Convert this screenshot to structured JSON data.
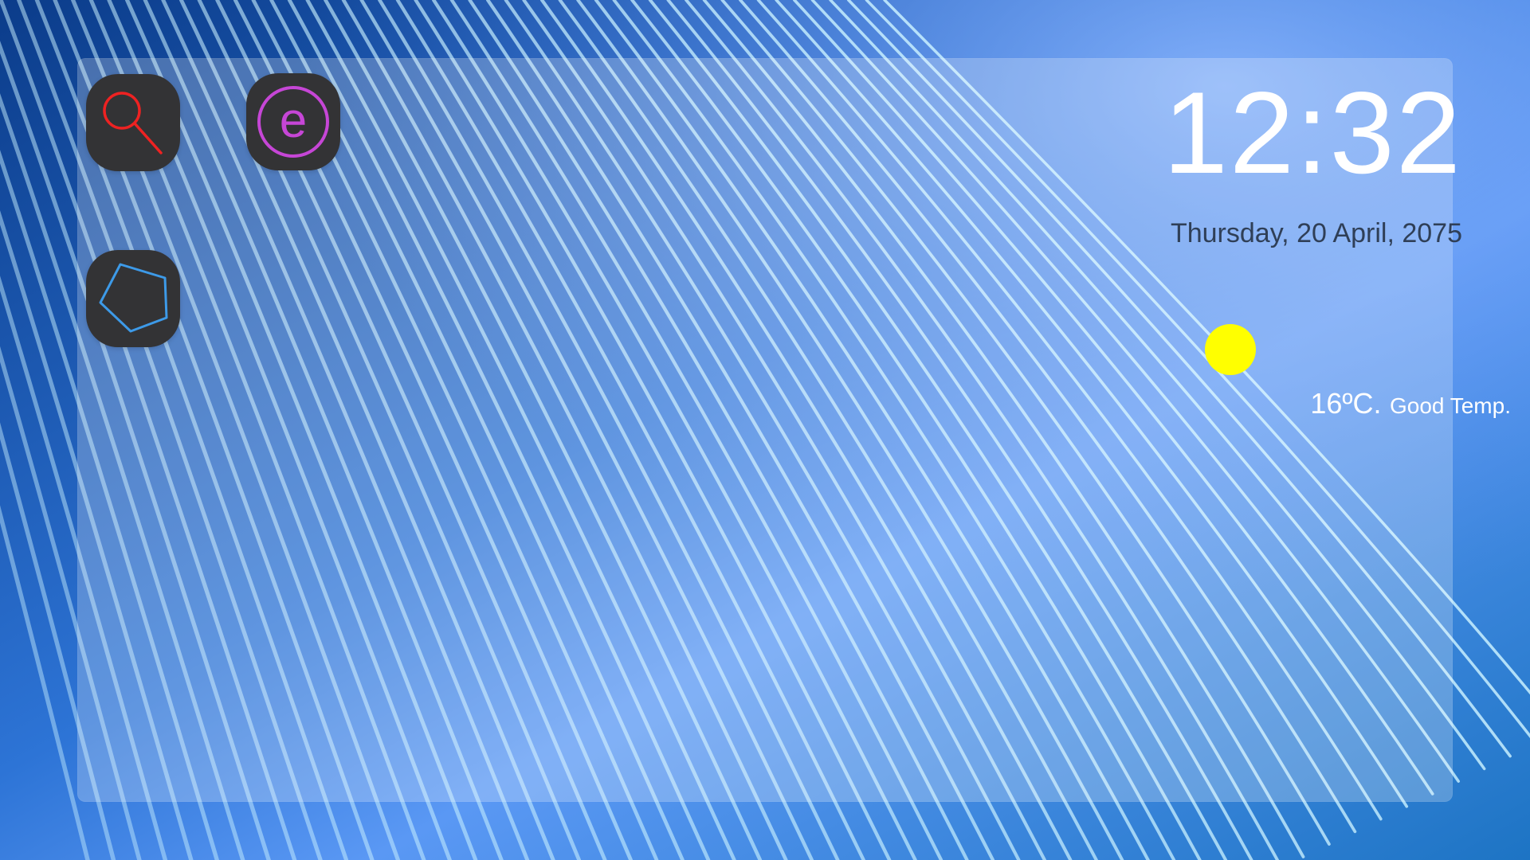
{
  "colors": {
    "panel_tint": "rgba(255,255,255,0.24)",
    "icon_tile": "#333335",
    "search_icon": "#ee2222",
    "edge_icon": "#c646d6",
    "shape_icon": "#3d9ae8",
    "sun": "#ffff00",
    "time_text": "#ffffff",
    "date_text": "#2f3f57",
    "line_color": "#c8f0ff"
  },
  "apps": [
    {
      "name": "search",
      "icon": "magnifier-icon"
    },
    {
      "name": "browser",
      "icon": "letter-e-circle-icon",
      "glyph": "e"
    },
    {
      "name": "shapes",
      "icon": "pentagon-icon"
    }
  ],
  "clock": {
    "time": "12:32",
    "date": "Thursday, 20 April, 2075"
  },
  "weather": {
    "icon": "sun-icon",
    "temperature": "16ºC.",
    "description": "Good Temp."
  }
}
